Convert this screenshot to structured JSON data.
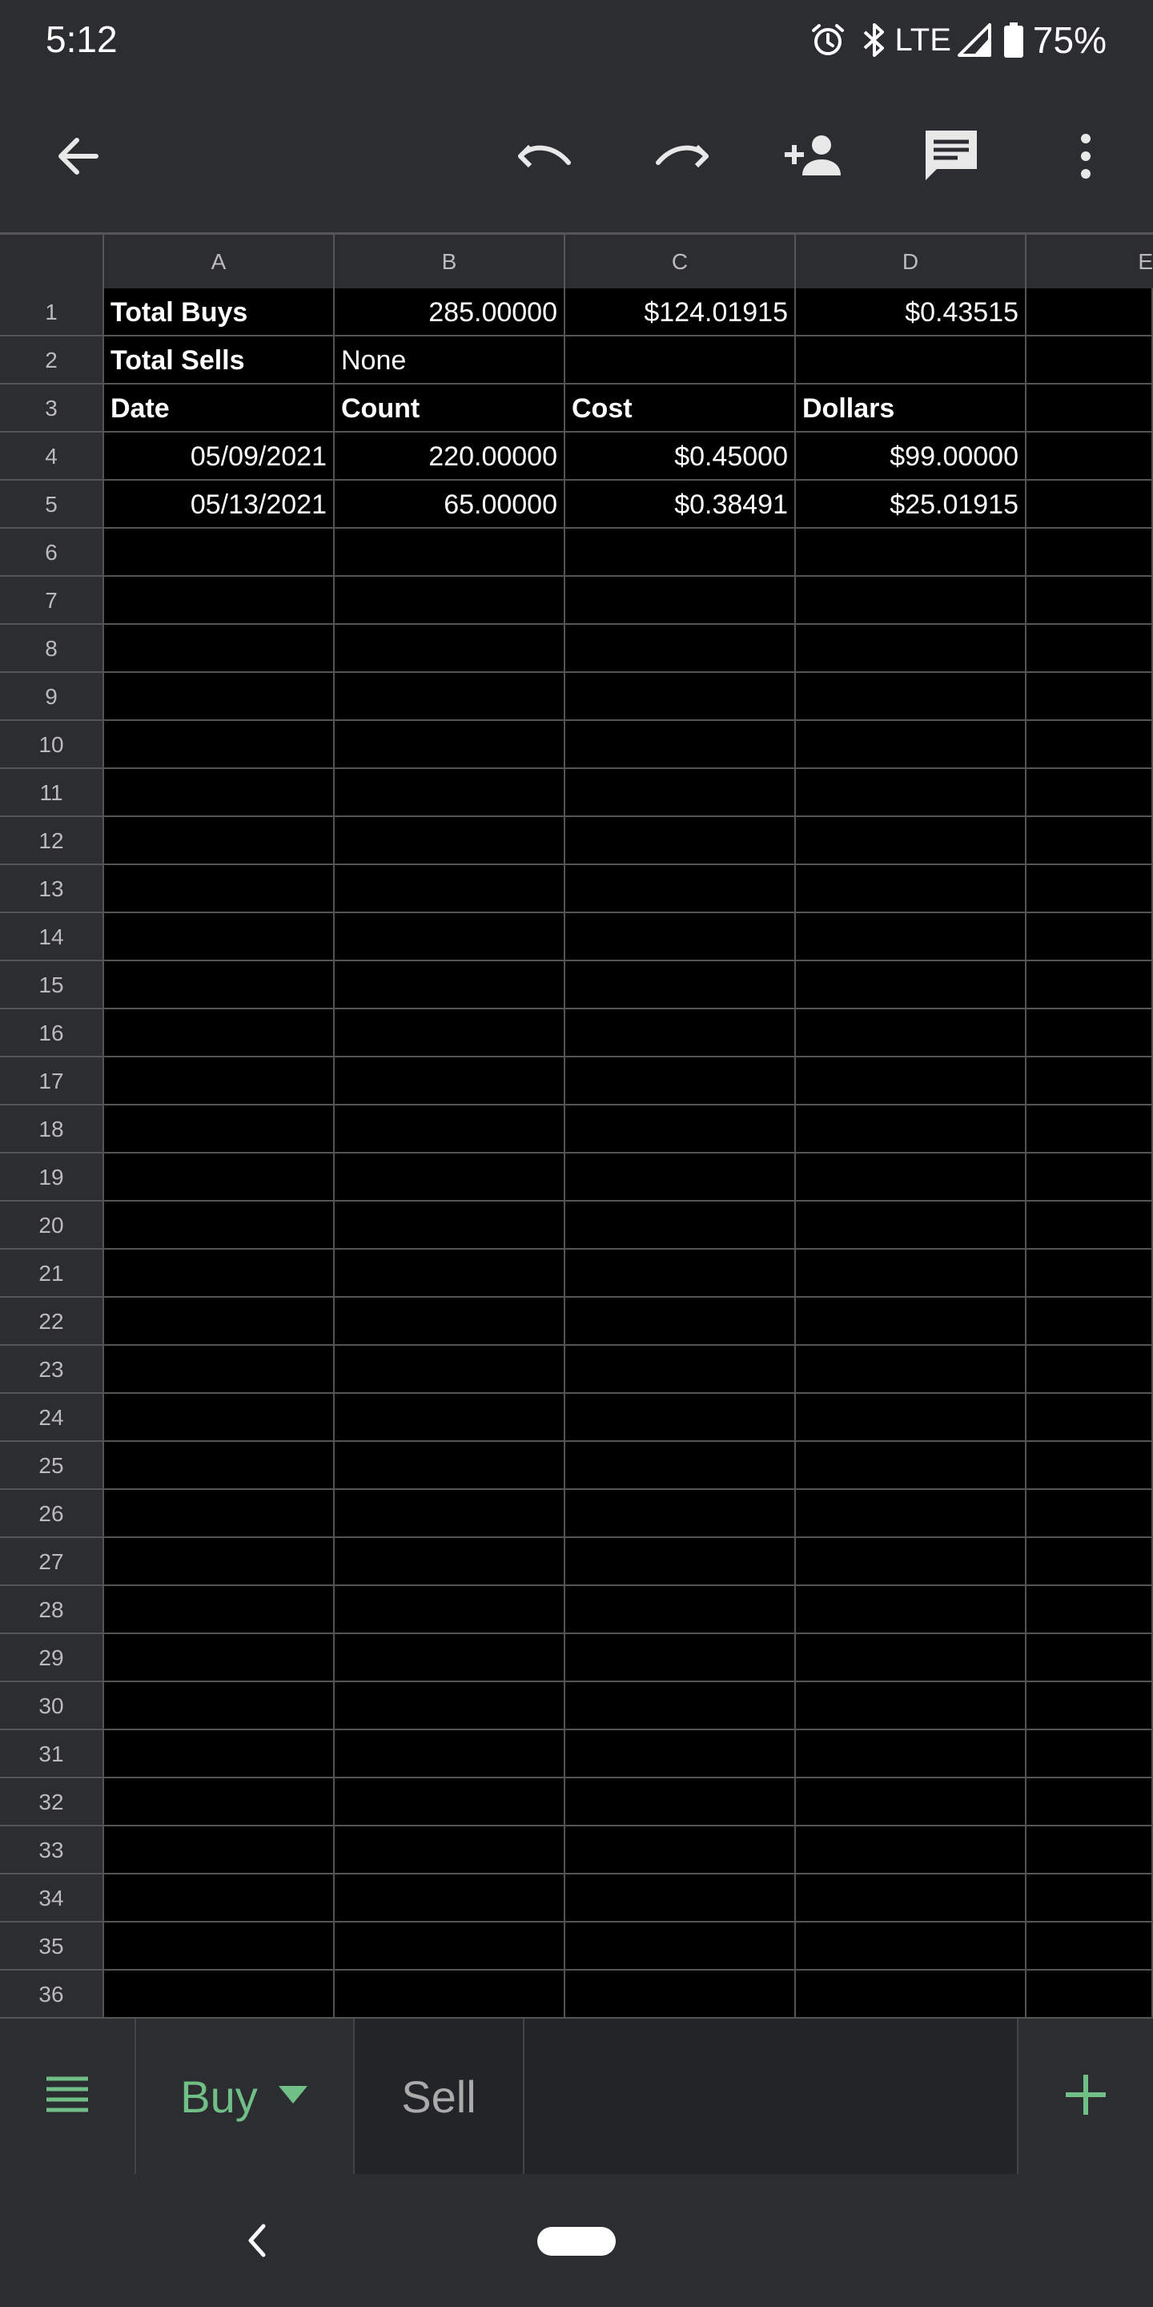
{
  "status_bar": {
    "time": "5:12",
    "network": "LTE",
    "battery": "75%",
    "icons": [
      "alarm-icon",
      "bluetooth-icon",
      "signal-icon",
      "battery-icon"
    ]
  },
  "toolbar": {
    "icons": [
      "back-arrow-icon",
      "undo-icon",
      "redo-icon",
      "add-person-icon",
      "comment-icon",
      "more-vert-icon"
    ]
  },
  "grid": {
    "columns": [
      "A",
      "B",
      "C",
      "D",
      "E"
    ],
    "row_numbers": [
      "1",
      "2",
      "3",
      "4",
      "5",
      "6",
      "7",
      "8",
      "9",
      "10",
      "11",
      "12",
      "13",
      "14",
      "15",
      "16",
      "17",
      "18",
      "19",
      "20",
      "21",
      "22",
      "23",
      "24",
      "25",
      "26",
      "27",
      "28",
      "29",
      "30",
      "31",
      "32",
      "33",
      "34",
      "35",
      "36"
    ],
    "cells": {
      "r1": {
        "a": "Total Buys",
        "b": "285.00000",
        "c": "$124.01915",
        "d": "$0.43515"
      },
      "r2": {
        "a": "Total Sells",
        "b": "None"
      },
      "r3": {
        "a": "Date",
        "b": "Count",
        "c": "Cost",
        "d": "Dollars"
      },
      "r4": {
        "a": "05/09/2021",
        "b": "220.00000",
        "c": "$0.45000",
        "d": "$99.00000"
      },
      "r5": {
        "a": "05/13/2021",
        "b": "65.00000",
        "c": "$0.38491",
        "d": "$25.01915"
      }
    }
  },
  "sheet_tabs": {
    "tabs": [
      {
        "label": "Buy",
        "active": true
      },
      {
        "label": "Sell",
        "active": false
      }
    ]
  },
  "colors": {
    "accent_green": "#6fbf86",
    "chrome": "#2c2d31",
    "grid_line": "#555555"
  }
}
